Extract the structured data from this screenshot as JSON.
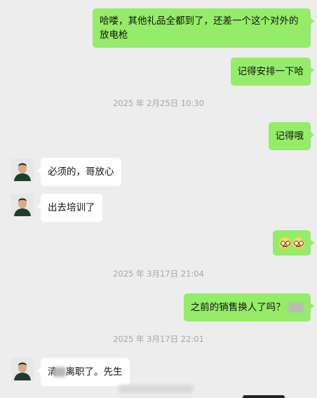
{
  "messages": [
    {
      "side": "me",
      "text": "哈喽，其他礼品全都到了，还差一个这个对外的放电枪"
    },
    {
      "side": "me",
      "text": "记得安排一下哈"
    },
    {
      "type": "timestamp",
      "text": "2025 年 2月25日 10:30"
    },
    {
      "side": "me",
      "text": "记得哦"
    },
    {
      "side": "them",
      "text": "必须的，哥放心"
    },
    {
      "side": "them",
      "text": "出去培训了"
    },
    {
      "side": "me",
      "emoji": [
        "confused-face-icon",
        "confused-face-icon"
      ]
    },
    {
      "type": "timestamp",
      "text": "2025 年 3月17日 21:04"
    },
    {
      "side": "me",
      "text": "之前的销售换人了吗？"
    },
    {
      "type": "timestamp",
      "text": "2025 年 3月17日 22:01"
    },
    {
      "side": "them",
      "text_prefix": "清",
      "text": "离职了。先生"
    }
  ],
  "colors": {
    "background": "#ededed",
    "my_bubble": "#95ec69",
    "their_bubble": "#ffffff",
    "timestamp": "#a6a6a6"
  }
}
